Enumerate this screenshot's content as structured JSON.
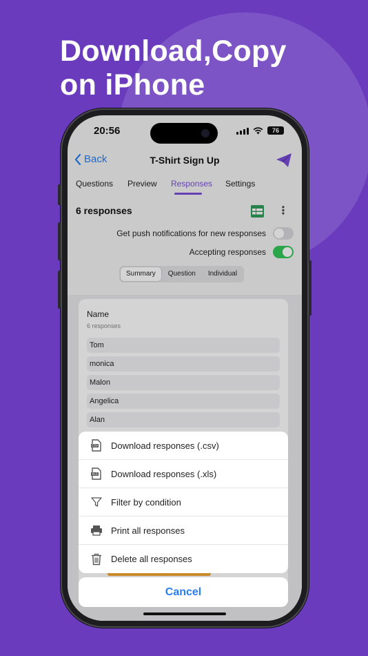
{
  "headline": {
    "line1": "Download,Copy",
    "line2": "on iPhone"
  },
  "status_bar": {
    "time": "20:56",
    "battery": "76"
  },
  "nav": {
    "back_label": "Back",
    "title": "T-Shirt Sign Up"
  },
  "tabs": [
    {
      "label": "Questions"
    },
    {
      "label": "Preview"
    },
    {
      "label": "Responses"
    },
    {
      "label": "Settings"
    }
  ],
  "responses_header": {
    "count_label": "6 responses",
    "push_label": "Get push notifications for new responses",
    "push_enabled": false,
    "accepting_label": "Accepting responses",
    "accepting_enabled": true
  },
  "segments": [
    {
      "label": "Summary",
      "selected": true
    },
    {
      "label": "Question",
      "selected": false
    },
    {
      "label": "Individual",
      "selected": false
    }
  ],
  "summary_card": {
    "title": "Name",
    "subtitle": "6 responses",
    "items": [
      "Tom",
      "monica",
      "Malon",
      "Angelica",
      "Alan"
    ]
  },
  "action_sheet": {
    "items": [
      {
        "label": "Download responses (.csv)",
        "icon": "csv-file-icon"
      },
      {
        "label": "Download responses (.xls)",
        "icon": "xls-file-icon"
      },
      {
        "label": "Filter by condition",
        "icon": "filter-icon"
      },
      {
        "label": "Print all responses",
        "icon": "printer-icon"
      },
      {
        "label": "Delete all responses",
        "icon": "trash-icon"
      }
    ],
    "cancel_label": "Cancel"
  },
  "colors": {
    "background": "#6a3bbd",
    "accent_purple": "#7a4dd6",
    "link_blue": "#2a7df0",
    "toggle_on": "#34c759",
    "sheet_green": "#2f9e5b"
  }
}
